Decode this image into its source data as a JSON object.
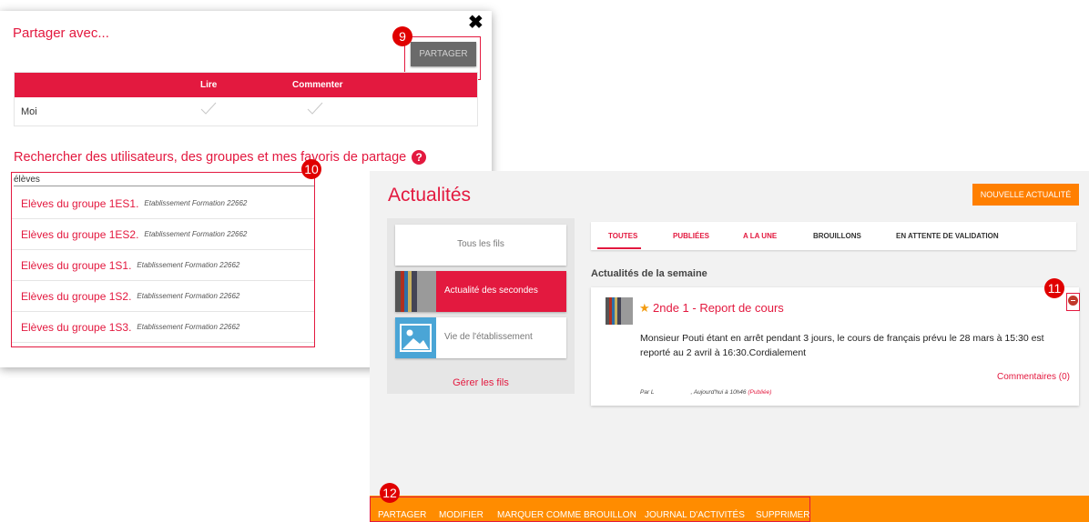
{
  "share_dialog": {
    "title": "Partager avec...",
    "close_glyph": "✖",
    "share_button": "PARTAGER",
    "columns": [
      "Lire",
      "Commenter"
    ],
    "rows": [
      {
        "name": "Moi",
        "read": true,
        "comment": true
      }
    ],
    "search_heading": "Rechercher des utilisateurs, des groupes et mes favoris de partage",
    "help_glyph": "?",
    "search_value": "élèves",
    "results": [
      {
        "name": "Elèves du groupe 1ES1.",
        "institution": "Etablissement Formation 22662"
      },
      {
        "name": "Elèves du groupe 1ES2.",
        "institution": "Etablissement Formation 22662"
      },
      {
        "name": "Elèves du groupe 1S1.",
        "institution": "Etablissement Formation 22662"
      },
      {
        "name": "Elèves du groupe 1S2.",
        "institution": "Etablissement Formation 22662"
      },
      {
        "name": "Elèves du groupe 1S3.",
        "institution": "Etablissement Formation 22662"
      }
    ]
  },
  "badges": [
    "9",
    "10",
    "11",
    "12"
  ],
  "news": {
    "title": "Actualités",
    "new_button": "NOUVELLE ACTUALITÉ",
    "feeds": [
      "Tous les fils",
      "Actualité des secondes",
      "Vie de l'établissement"
    ],
    "manage_feeds": "Gérer les fils",
    "tabs": [
      "TOUTES",
      "PUBLIÉES",
      "A LA UNE",
      "BROUILLONS",
      "EN ATTENTE DE VALIDATION"
    ],
    "active_tab": "TOUTES",
    "week_label": "Actualités de la semaine",
    "article": {
      "title": "2nde 1 - Report de cours",
      "body": "Monsieur Pouti étant en arrêt pendant 3 jours, le cours de français prévu le 28 mars à 15:30 est reporté au 2 avril à 16:30.Cordialement",
      "comments": "Commentaires (0)",
      "author_prefix": "Par L",
      "date": ", Aujourd'hui à 10h46",
      "status": "(Publiée)"
    },
    "actions": [
      "PARTAGER",
      "MODIFIER",
      "MARQUER COMME BROUILLON",
      "JOURNAL D'ACTIVITÉS",
      "SUPPRIMER"
    ]
  },
  "colors": {
    "accent": "#e3193f",
    "orange": "#ff8c00",
    "badge": "#e00000"
  }
}
